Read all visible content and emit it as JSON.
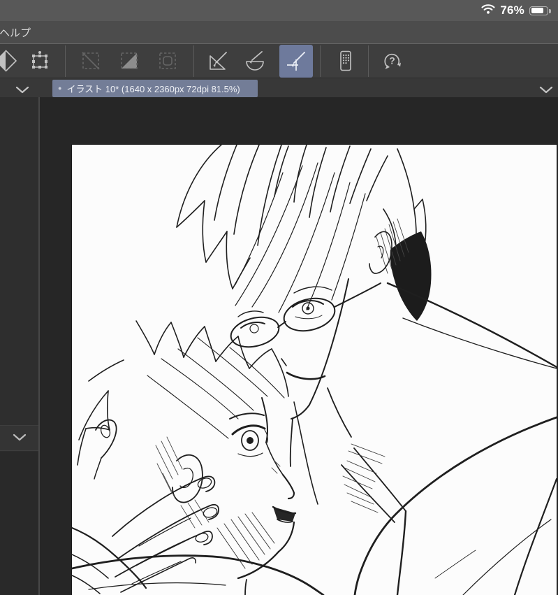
{
  "status_bar": {
    "battery_percent": "76%",
    "wifi_icon": "wifi",
    "battery_icon": "battery-mostly-full"
  },
  "menu_bar": {
    "help_label": "ヘルプ"
  },
  "toolbar": {
    "icon_names": [
      "blend-tool",
      "transform-tool",
      "deselect",
      "invert-selection",
      "selection-border",
      "snap-to-ruler",
      "snap-to-curve-ruler",
      "snap-to-special-ruler",
      "companion-mode",
      "quick-help"
    ],
    "selected_tool": "snap-to-special-ruler"
  },
  "tab_bar": {
    "active_tab": {
      "modified_indicator": "●",
      "title": "イラスト 10* (1640 x 2360px 72dpi 81.5%)"
    }
  },
  "colors": {
    "selection_accent": "#6e7a9c",
    "tab_highlight": "#737d97",
    "status_bar_bg": "#585858",
    "menu_bar_bg": "#4c4c4c",
    "toolbar_bg": "#3e3e3e",
    "tab_bar_bg": "#383838",
    "sidebar_bg": "#2d2d2d",
    "canvas_gutter_bg": "#262626",
    "paper_color": "#fcfcfc",
    "line_art_color": "#1f1f1f"
  }
}
